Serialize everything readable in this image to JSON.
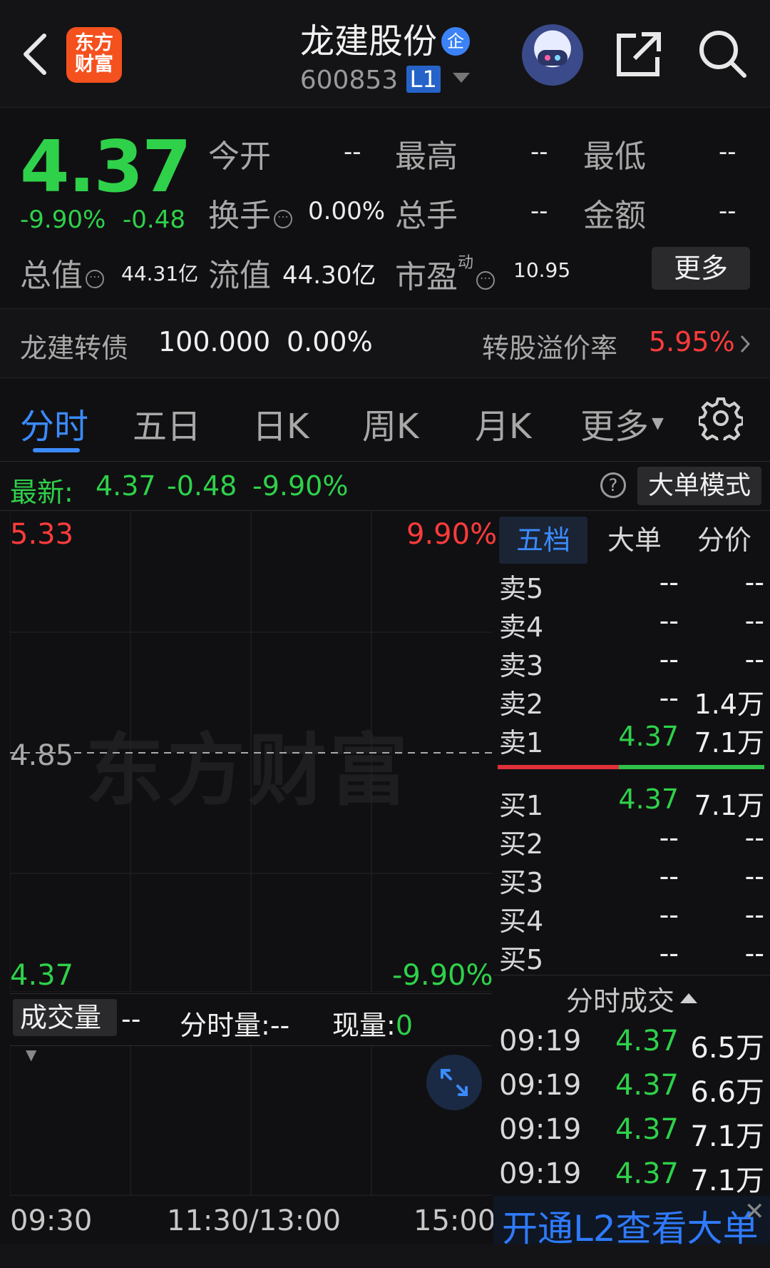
{
  "header": {
    "title": "龙建股份",
    "title_badge": "企",
    "stock_code": "600853",
    "level_badge": "L1",
    "logo_line1": "东方",
    "logo_line2": "财富"
  },
  "quote": {
    "price": "4.37",
    "change_pct": "-9.90%",
    "change": "-0.48",
    "fields": {
      "open_label": "今开",
      "open_value": "--",
      "high_label": "最高",
      "high_value": "--",
      "low_label": "最低",
      "low_value": "--",
      "turnover_label": "换手",
      "turnover_value": "0.00%",
      "total_hands_label": "总手",
      "total_hands_value": "--",
      "amount_label": "金额",
      "amount_value": "--",
      "market_cap_label": "总值",
      "market_cap_value": "44.31亿",
      "float_cap_label": "流值",
      "float_cap_value": "44.30亿",
      "pe_label": "市盈",
      "pe_sup": "动",
      "pe_value": "10.95"
    },
    "more_label": "更多"
  },
  "bond": {
    "name": "龙建转债",
    "price": "100.000",
    "change": "0.00%",
    "premium_label": "转股溢价率",
    "premium_value": "5.95%"
  },
  "tabs": [
    "分时",
    "五日",
    "日K",
    "周K",
    "月K",
    "更多"
  ],
  "latest": {
    "label": "最新:",
    "price": "4.37",
    "change": "-0.48",
    "pct": "-9.90%",
    "big_order_mode": "大单模式"
  },
  "chart": {
    "top_price": "5.33",
    "top_pct": "9.90%",
    "mid_price": "4.85",
    "bottom_price": "4.37",
    "bottom_pct": "-9.90%",
    "watermark": "东方财富"
  },
  "volume": {
    "selector": "成交量",
    "selector_value": "--",
    "timeshare_label": "分时量:",
    "timeshare_value": "--",
    "current_label": "现量:",
    "current_value": "0"
  },
  "time_axis": [
    "09:30",
    "11:30/13:00",
    "15:00"
  ],
  "order_book": {
    "tabs": [
      "五档",
      "大单",
      "分价"
    ],
    "asks": [
      {
        "name": "卖5",
        "price": "--",
        "vol": "--"
      },
      {
        "name": "卖4",
        "price": "--",
        "vol": "--"
      },
      {
        "name": "卖3",
        "price": "--",
        "vol": "--"
      },
      {
        "name": "卖2",
        "price": "--",
        "vol": "1.4万"
      },
      {
        "name": "卖1",
        "price": "4.37",
        "vol": "7.1万"
      }
    ],
    "bids": [
      {
        "name": "买1",
        "price": "4.37",
        "vol": "7.1万"
      },
      {
        "name": "买2",
        "price": "--",
        "vol": "--"
      },
      {
        "name": "买3",
        "price": "--",
        "vol": "--"
      },
      {
        "name": "买4",
        "price": "--",
        "vol": "--"
      },
      {
        "name": "买5",
        "price": "--",
        "vol": "--"
      }
    ]
  },
  "trades": {
    "title": "分时成交",
    "rows": [
      {
        "time": "09:19",
        "price": "4.37",
        "vol": "6.5万"
      },
      {
        "time": "09:19",
        "price": "4.37",
        "vol": "6.6万"
      },
      {
        "time": "09:19",
        "price": "4.37",
        "vol": "7.1万"
      },
      {
        "time": "09:19",
        "price": "4.37",
        "vol": "7.1万"
      }
    ]
  },
  "l2_banner": "开通L2查看大单",
  "colors": {
    "up": "#ff3b3b",
    "down": "#2fd14a",
    "accent": "#3b8bff",
    "background": "#101012"
  }
}
